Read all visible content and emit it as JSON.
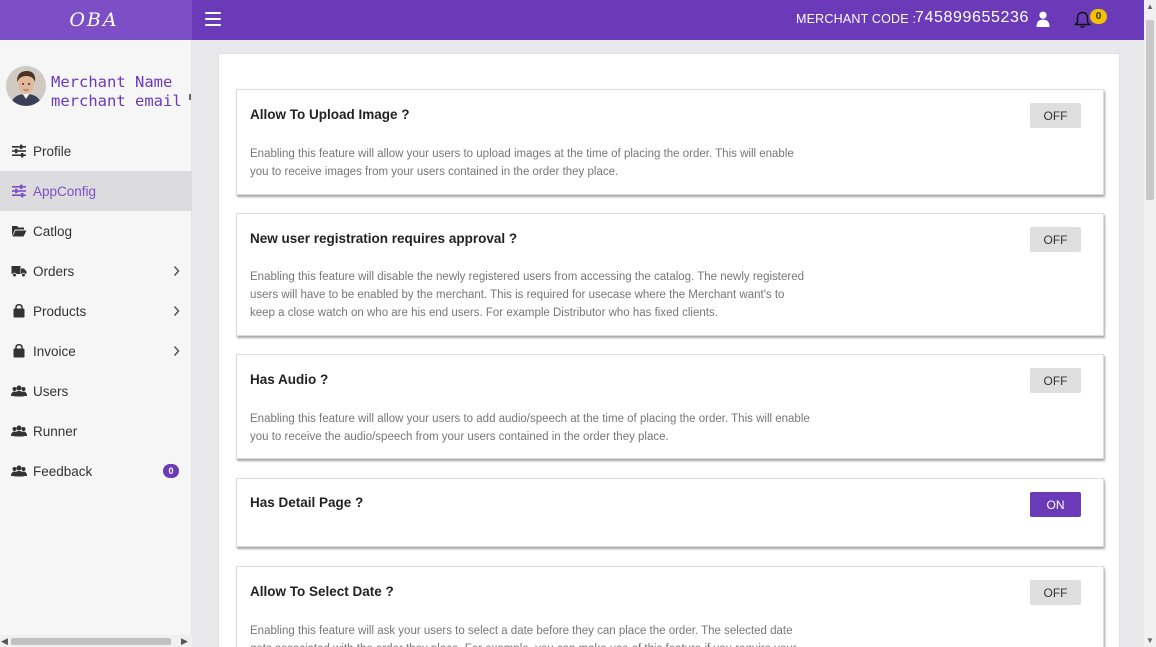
{
  "brand": {
    "logo_text": "OBA"
  },
  "header": {
    "merchant_code_label": "MERCHANT CODE :",
    "merchant_code": "745899655236",
    "notification_count": "0",
    "icons": [
      "menu-icon",
      "user-icon",
      "bell-icon"
    ]
  },
  "sidebar": {
    "merchant_name": "Merchant Name",
    "merchant_email": "merchant email",
    "items": [
      {
        "label": "Profile",
        "icon": "sliders-icon"
      },
      {
        "label": "AppConfig",
        "icon": "sliders-icon",
        "active": true
      },
      {
        "label": "Catlog",
        "icon": "folder-icon"
      },
      {
        "label": "Orders",
        "icon": "truck-icon",
        "submenu": true
      },
      {
        "label": "Products",
        "icon": "bag-icon",
        "submenu": true
      },
      {
        "label": "Invoice",
        "icon": "bag-icon",
        "submenu": true
      },
      {
        "label": "Users",
        "icon": "users-icon"
      },
      {
        "label": "Runner",
        "icon": "users-icon"
      },
      {
        "label": "Feedback",
        "icon": "users-icon",
        "badge": "0"
      }
    ]
  },
  "settings": [
    {
      "title": "Allow To Upload Image ?",
      "description": "Enabling this feature will allow your users to upload images at the time of placing the order. This will enable you to receive images from your users contained in the order they place.",
      "state": "OFF"
    },
    {
      "title": "New user registration requires approval ?",
      "description": "Enabling this feature will disable the newly registered users from accessing the catalog. The newly registered users will have to be enabled by the merchant. This is required for usecase where the Merchant want's to keep a close watch on who are his end users. For example Distributor who has fixed clients.",
      "state": "OFF"
    },
    {
      "title": "Has Audio ?",
      "description": "Enabling this feature will allow your users to add audio/speech at the time of placing the order. This will enable you to receive the audio/speech from your users contained in the order they place.",
      "state": "OFF"
    },
    {
      "title": "Has Detail Page ?",
      "description": "",
      "state": "ON"
    },
    {
      "title": "Allow To Select Date ?",
      "description": "Enabling this feature will ask your users to select a date before they can place the order. The selected date gets associated with the order they place. For example, you can make use of this feature if you require your",
      "state": "OFF"
    }
  ],
  "colors": {
    "accent": "#6a3ab8",
    "toggle_off": "#dedede"
  }
}
